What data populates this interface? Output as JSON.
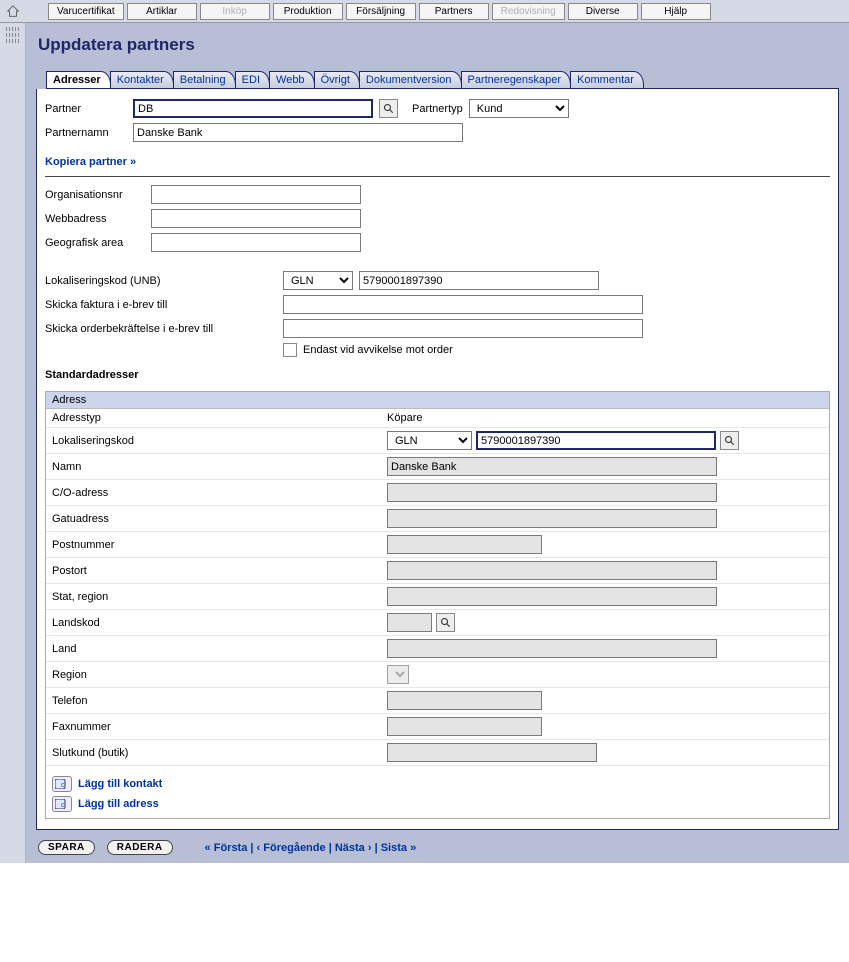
{
  "topbar": {
    "buttons": [
      {
        "label": "Varucertifikat",
        "disabled": false
      },
      {
        "label": "Artiklar",
        "disabled": false
      },
      {
        "label": "Inköp",
        "disabled": true
      },
      {
        "label": "Produktion",
        "disabled": false
      },
      {
        "label": "Försäljning",
        "disabled": false
      },
      {
        "label": "Partners",
        "disabled": false
      },
      {
        "label": "Redovisning",
        "disabled": true
      },
      {
        "label": "Diverse",
        "disabled": false
      },
      {
        "label": "Hjälp",
        "disabled": false
      }
    ]
  },
  "page_title": "Uppdatera partners",
  "tabs": [
    {
      "label": "Adresser",
      "active": true
    },
    {
      "label": "Kontakter",
      "active": false
    },
    {
      "label": "Betalning",
      "active": false
    },
    {
      "label": "EDI",
      "active": false
    },
    {
      "label": "Webb",
      "active": false
    },
    {
      "label": "Övrigt",
      "active": false
    },
    {
      "label": "Dokumentversion",
      "active": false
    },
    {
      "label": "Partneregenskaper",
      "active": false
    },
    {
      "label": "Kommentar",
      "active": false
    }
  ],
  "partner": {
    "label": "Partner",
    "value": "DB",
    "type_label": "Partnertyp",
    "type_value": "Kund",
    "name_label": "Partnernamn",
    "name_value": "Danske Bank"
  },
  "copy_link": "Kopiera partner »",
  "org": {
    "orgnr_label": "Organisationsnr",
    "orgnr_value": "",
    "web_label": "Webbadress",
    "web_value": "",
    "geo_label": "Geografisk area",
    "geo_value": ""
  },
  "loc": {
    "lokkod_label": "Lokaliseringskod (UNB)",
    "lokkod_type": "GLN",
    "lokkod_value": "5790001897390",
    "faktura_label": "Skicka faktura i e-brev till",
    "faktura_value": "",
    "orderbek_label": "Skicka orderbekräftelse i e-brev till",
    "orderbek_value": "",
    "checkbox_label": "Endast vid avvikelse mot order"
  },
  "std_adr_head": "Standardadresser",
  "address": {
    "block_title": "Adress",
    "rows": {
      "adresstyp": {
        "label": "Adresstyp",
        "value": "Köpare"
      },
      "lokkod": {
        "label": "Lokaliseringskod",
        "type": "GLN",
        "value": "5790001897390"
      },
      "namn": {
        "label": "Namn",
        "value": "Danske Bank"
      },
      "co": {
        "label": "C/O-adress",
        "value": ""
      },
      "gatu": {
        "label": "Gatuadress",
        "value": ""
      },
      "postnr": {
        "label": "Postnummer",
        "value": ""
      },
      "postort": {
        "label": "Postort",
        "value": ""
      },
      "stat": {
        "label": "Stat, region",
        "value": ""
      },
      "landskod": {
        "label": "Landskod",
        "value": ""
      },
      "land": {
        "label": "Land",
        "value": ""
      },
      "region": {
        "label": "Region",
        "value": ""
      },
      "telefon": {
        "label": "Telefon",
        "value": ""
      },
      "fax": {
        "label": "Faxnummer",
        "value": ""
      },
      "slutkund": {
        "label": "Slutkund (butik)",
        "value": ""
      }
    }
  },
  "actions": {
    "add_contact": "Lägg till kontakt",
    "add_address": "Lägg till adress"
  },
  "footer": {
    "save": "SPARA",
    "delete": "RADERA",
    "first": "« Första",
    "prev": "‹ Föregående",
    "next": "Nästa ›",
    "last": "Sista »",
    "sep": " | "
  }
}
